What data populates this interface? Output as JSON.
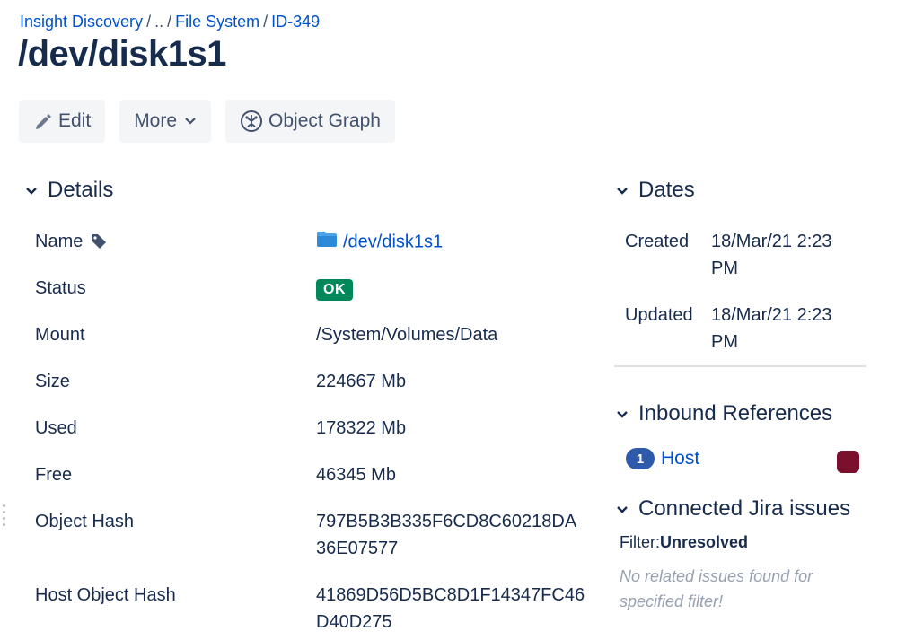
{
  "breadcrumb": {
    "items": [
      "Insight Discovery",
      "..",
      "File System",
      "ID-349"
    ],
    "separator": "/"
  },
  "page_title": "/dev/disk1s1",
  "toolbar": {
    "edit_label": "Edit",
    "more_label": "More",
    "graph_label": "Object Graph"
  },
  "details": {
    "heading": "Details",
    "rows": [
      {
        "label": "Name",
        "value": "/dev/disk1s1"
      },
      {
        "label": "Status",
        "value": "OK"
      },
      {
        "label": "Mount",
        "value": "/System/Volumes/Data"
      },
      {
        "label": "Size",
        "value": "224667 Mb"
      },
      {
        "label": "Used",
        "value": "178322 Mb"
      },
      {
        "label": "Free",
        "value": "46345 Mb"
      },
      {
        "label": "Object Hash",
        "value": "797B5B3B335F6CD8C60218DA36E07577"
      },
      {
        "label": "Host Object Hash",
        "value": "41869D56D5BC8D1F14347FC46D40D275"
      }
    ]
  },
  "dates": {
    "heading": "Dates",
    "created_label": "Created",
    "created_value": "18/Mar/21 2:23 PM",
    "updated_label": "Updated",
    "updated_value": "18/Mar/21 2:23 PM"
  },
  "inbound": {
    "heading": "Inbound References",
    "count": "1",
    "link": "Host",
    "swatch_color": "#7a0f2e"
  },
  "jira": {
    "heading": "Connected Jira issues",
    "filter_label": "Filter:",
    "filter_value": "Unresolved",
    "empty_message": "No related issues found for specified filter!"
  },
  "colors": {
    "link": "#0052cc",
    "status_ok": "#00875a",
    "text": "#172b4d"
  }
}
